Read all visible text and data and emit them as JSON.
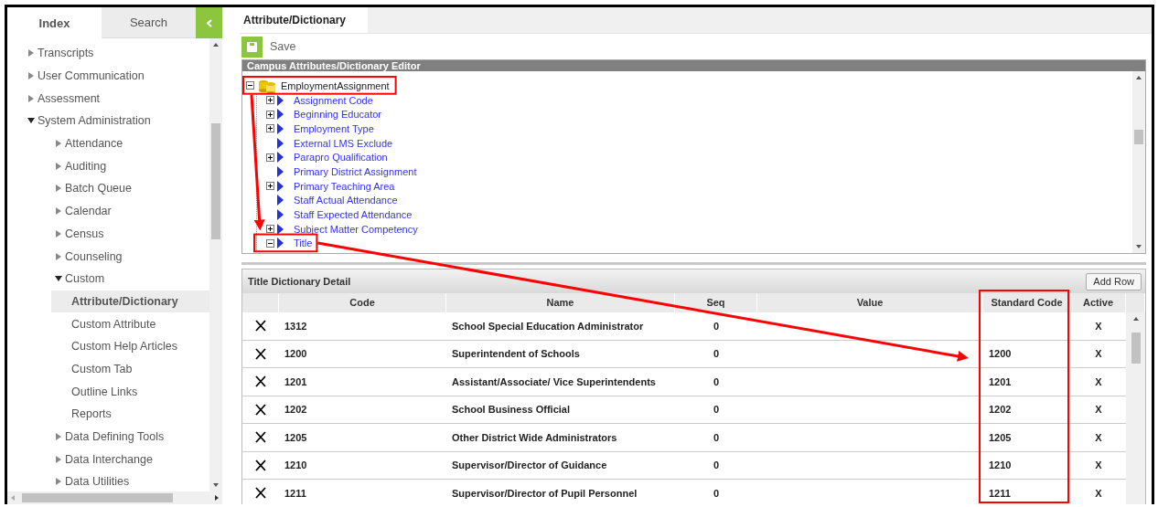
{
  "sidebar": {
    "tabs": [
      {
        "label": "Index",
        "selected": true
      },
      {
        "label": "Search",
        "selected": false
      }
    ],
    "items": [
      {
        "label": "Transcripts",
        "expanded": false
      },
      {
        "label": "User Communication",
        "expanded": false
      },
      {
        "label": "Assessment",
        "expanded": false
      },
      {
        "label": "System Administration",
        "expanded": true,
        "children": [
          {
            "label": "Attendance",
            "expanded": false
          },
          {
            "label": "Auditing",
            "expanded": false
          },
          {
            "label": "Batch Queue",
            "expanded": false
          },
          {
            "label": "Calendar",
            "expanded": false
          },
          {
            "label": "Census",
            "expanded": false
          },
          {
            "label": "Counseling",
            "expanded": false
          },
          {
            "label": "Custom",
            "expanded": true,
            "children": [
              {
                "label": "Attribute/Dictionary",
                "selected": true
              },
              {
                "label": "Custom Attribute",
                "selected": false
              },
              {
                "label": "Custom Help Articles",
                "selected": false
              },
              {
                "label": "Custom Tab",
                "selected": false
              },
              {
                "label": "Outline Links",
                "selected": false
              },
              {
                "label": "Reports",
                "selected": false
              }
            ]
          },
          {
            "label": "Data Defining Tools",
            "expanded": false
          },
          {
            "label": "Data Interchange",
            "expanded": false
          },
          {
            "label": "Data Utilities",
            "expanded": false
          }
        ]
      }
    ]
  },
  "tabs": [
    {
      "label": "Attribute/Dictionary",
      "selected": true
    }
  ],
  "toolbar": {
    "save": "Save"
  },
  "editor": {
    "title": "Campus Attributes/Dictionary Editor",
    "tree": {
      "label": "EmploymentAssignment",
      "expanded": true,
      "children": [
        {
          "label": "Assignment Code",
          "kind": "folder",
          "expanded": false
        },
        {
          "label": "Beginning Educator",
          "kind": "folder",
          "expanded": false
        },
        {
          "label": "Employment Type",
          "kind": "folder",
          "expanded": false
        },
        {
          "label": "External LMS Exclude",
          "kind": "leaf"
        },
        {
          "label": "Parapro Qualification",
          "kind": "folder",
          "expanded": false
        },
        {
          "label": "Primary District Assignment",
          "kind": "leaf"
        },
        {
          "label": "Primary Teaching Area",
          "kind": "folder",
          "expanded": false
        },
        {
          "label": "Staff Actual Attendance",
          "kind": "leaf"
        },
        {
          "label": "Staff Expected Attendance",
          "kind": "leaf"
        },
        {
          "label": "Subject Matter Competency",
          "kind": "folder",
          "expanded": false
        },
        {
          "label": "Title",
          "kind": "folder",
          "expanded": true
        }
      ]
    }
  },
  "detail": {
    "title": "Title Dictionary Detail",
    "add_button": "Add Row",
    "columns": [
      "Code",
      "Name",
      "Seq",
      "Value",
      "Standard Code",
      "Active"
    ],
    "rows": [
      {
        "code": "1312",
        "name": "School Special Education Administrator",
        "seq": "0",
        "active": "X"
      },
      {
        "code": "1200",
        "name": "Superintendent of Schools",
        "seq": "0",
        "standard_code": "1200",
        "active": "X"
      },
      {
        "code": "1201",
        "name": "Assistant/Associate/ Vice Superintendents",
        "seq": "0",
        "standard_code": "1201",
        "active": "X"
      },
      {
        "code": "1202",
        "name": "School Business Official",
        "seq": "0",
        "standard_code": "1202",
        "active": "X"
      },
      {
        "code": "1205",
        "name": "Other District Wide Administrators",
        "seq": "0",
        "standard_code": "1205",
        "active": "X"
      },
      {
        "code": "1210",
        "name": "Supervisor/Director of Guidance",
        "seq": "0",
        "standard_code": "1210",
        "active": "X"
      },
      {
        "code": "1211",
        "name": "Supervisor/Director of Pupil Personnel",
        "seq": "0",
        "standard_code": "1211",
        "active": "X"
      }
    ]
  }
}
